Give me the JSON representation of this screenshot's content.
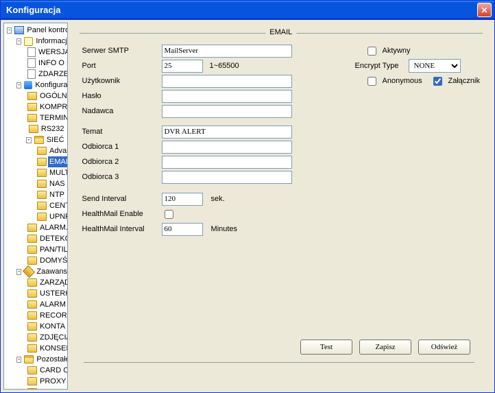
{
  "window": {
    "title": "Konfiguracja"
  },
  "tree": {
    "root": "Panel kontrolny",
    "informacje": {
      "label": "Informacje",
      "wersja": "WERSJA",
      "info_hdd": "INFO O HDD",
      "zdarzenia": "ZDARZENIA"
    },
    "konfiguracja": {
      "label": "Konfiguracja",
      "ogolne": "OGÓLNE",
      "kompresja": "KOMPRESJA",
      "terminarz": "TERMINARZ",
      "rs232": "RS232",
      "siec": {
        "label": "SIEĆ",
        "advance": "Advance",
        "email": "EMAIL",
        "multiddns": "MULTI-DDNS",
        "nas": "NAS",
        "ntp": "NTP",
        "centrum_alarm": "CENTRUM ALARM",
        "upnp": "UPNP"
      },
      "alarm": "ALARM.",
      "detekcja": "DETEKCJA",
      "ptz": "PAN/TILT/ZOOM",
      "domyslne": "DOMYŚLNE/BACKUP"
    },
    "zaawansowane": {
      "label": "Zaawansowane",
      "hdd": "ZARZĄDZANIE HDD",
      "usterki": "USTERKI",
      "alarm_konfig": "ALARM KONFIG.",
      "record_control": "RECORD CONTROL",
      "konta": "KONTA",
      "zdjecia": "ZDJĘCIA",
      "konserwacja": "KONSERWACJA"
    },
    "pozostale": {
      "label": "Pozostałe",
      "card_overlay": "CARD OVERLAY",
      "proxy": "PROXY SERWER",
      "serwery_dns_cut": "SERWERY DNS"
    }
  },
  "form": {
    "group_title": "EMAIL",
    "smtp_label": "Serwer SMTP",
    "smtp_value": "MailServer",
    "port_label": "Port",
    "port_value": "25",
    "port_hint": "1~65500",
    "user_label": "Użytkownik",
    "user_value": "",
    "pass_label": "Hasło",
    "pass_value": "",
    "sender_label": "Nadawca",
    "sender_value": "",
    "subject_label": "Temat",
    "subject_value": "DVR ALERT",
    "rcpt1_label": "Odbiorca 1",
    "rcpt1_value": "",
    "rcpt2_label": "Odbiorca 2",
    "rcpt2_value": "",
    "rcpt3_label": "Odbiorca 3",
    "rcpt3_value": "",
    "send_interval_label": "Send Interval",
    "send_interval_value": "120",
    "send_interval_unit": "sek.",
    "healthmail_enable_label": "HealthMail Enable",
    "healthmail_interval_label": "HealthMail Interval",
    "healthmail_interval_value": "60",
    "healthmail_interval_unit": "Minutes",
    "active_label": "Aktywny",
    "encrypt_label": "Encrypt Type",
    "encrypt_value": "NONE",
    "anonymous_label": "Anonymous",
    "attachment_label": "Załącznik"
  },
  "buttons": {
    "test": "Test",
    "save": "Zapisz",
    "refresh": "Odśwież"
  }
}
